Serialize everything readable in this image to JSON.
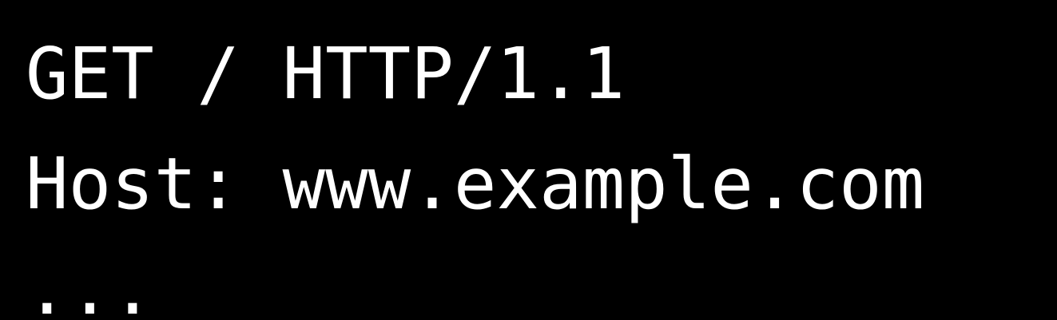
{
  "terminal": {
    "background_color": "#000000",
    "text_color": "#ffffff",
    "lines": [
      "GET / HTTP/1.1",
      "Host: www.example.com",
      "..."
    ]
  }
}
